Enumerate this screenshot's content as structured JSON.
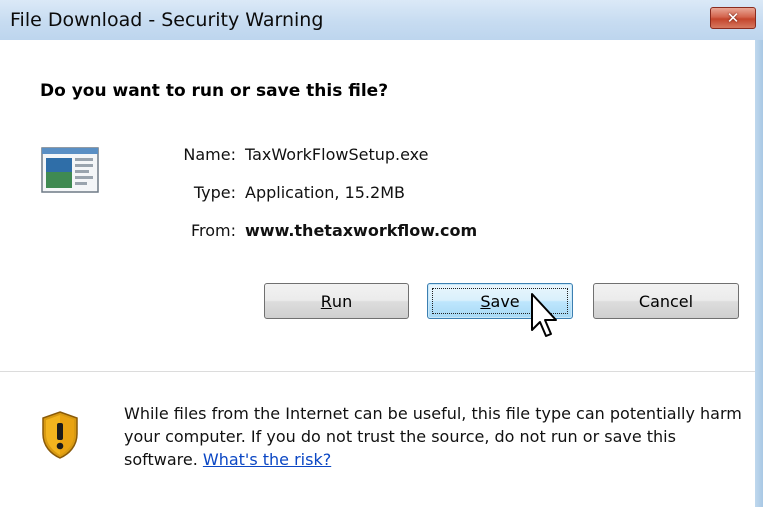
{
  "window": {
    "title": "File Download - Security Warning",
    "close_glyph": "✕"
  },
  "dialog": {
    "question": "Do you want to run or save this file?",
    "file_icon": "application-window-icon",
    "fields": {
      "name_label": "Name:",
      "name_value": "TaxWorkFlowSetup.exe",
      "type_label": "Type:",
      "type_value": "Application, 15.2MB",
      "from_label": "From:",
      "from_value": "www.thetaxworkflow.com"
    },
    "buttons": {
      "run_mnemonic": "R",
      "run_rest": "un",
      "save_mnemonic": "S",
      "save_rest": "ave",
      "cancel": "Cancel"
    },
    "warning": {
      "icon": "security-shield-icon",
      "text": "While files from the Internet can be useful, this file type can potentially harm your computer. If you do not trust the source, do not run or save this software.",
      "link": "What's the risk?"
    }
  },
  "colors": {
    "title_bar": "#c7dcf1",
    "close_button": "#c4452c",
    "link": "#0b47c4",
    "shield_gold": "#f2b41e"
  }
}
